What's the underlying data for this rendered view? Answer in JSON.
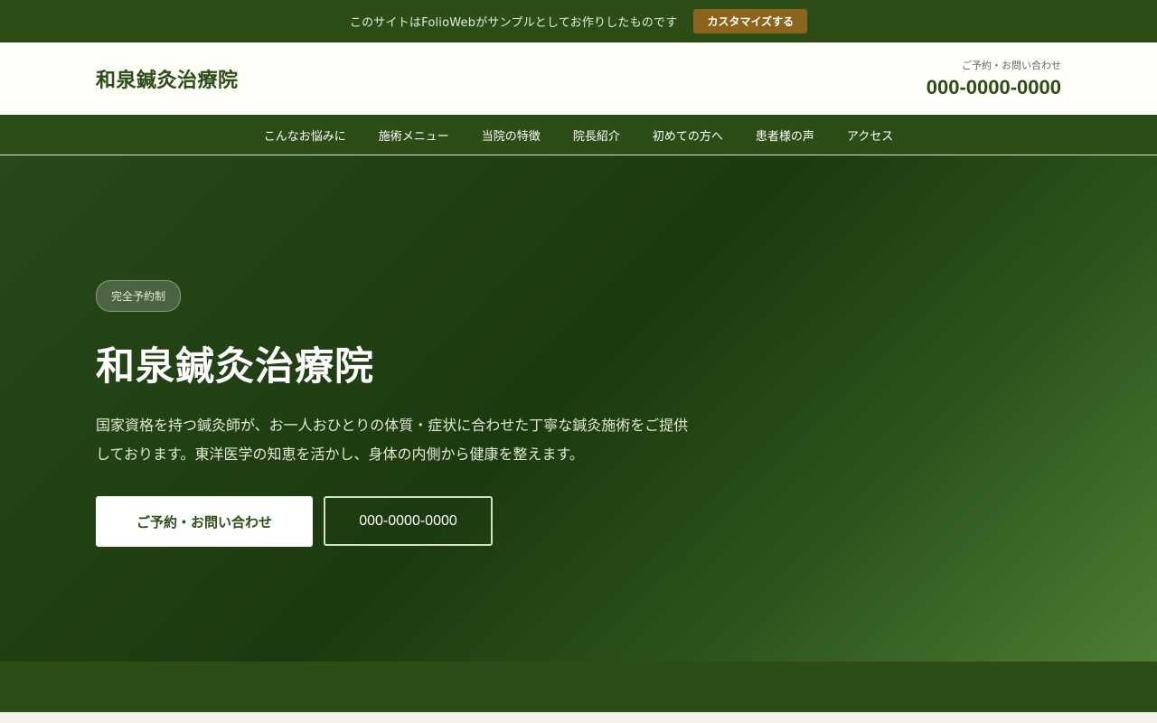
{
  "topbar": {
    "notice": "このサイトはFolioWebがサンプルとしてお作りしたものです",
    "customize_label": "カスタマイズする"
  },
  "header": {
    "logo": "和泉鍼灸治療院",
    "contact_label": "ご予約・お問い合わせ",
    "phone": "000-0000-0000"
  },
  "nav": {
    "items": [
      {
        "label": "こんなお悩みに"
      },
      {
        "label": "施術メニュー"
      },
      {
        "label": "当院の特徴"
      },
      {
        "label": "院長紹介"
      },
      {
        "label": "初めての方へ"
      },
      {
        "label": "患者様の声"
      },
      {
        "label": "アクセス"
      }
    ]
  },
  "hero": {
    "badge": "完全予約制",
    "title": "和泉鍼灸治療院",
    "description": "国家資格を持つ鍼灸師が、お一人おひとりの体質・症状に合わせた丁寧な鍼灸施術をご提供しております。東洋医学の知恵を活かし、身体の内側から健康を整えます。",
    "primary_button": "ご予約・お問い合わせ",
    "phone_button": "000-0000-0000"
  },
  "colors": {
    "brand_green": "#2d4d17",
    "accent_gold": "#8a651b",
    "header_bg": "#fefdf7"
  }
}
